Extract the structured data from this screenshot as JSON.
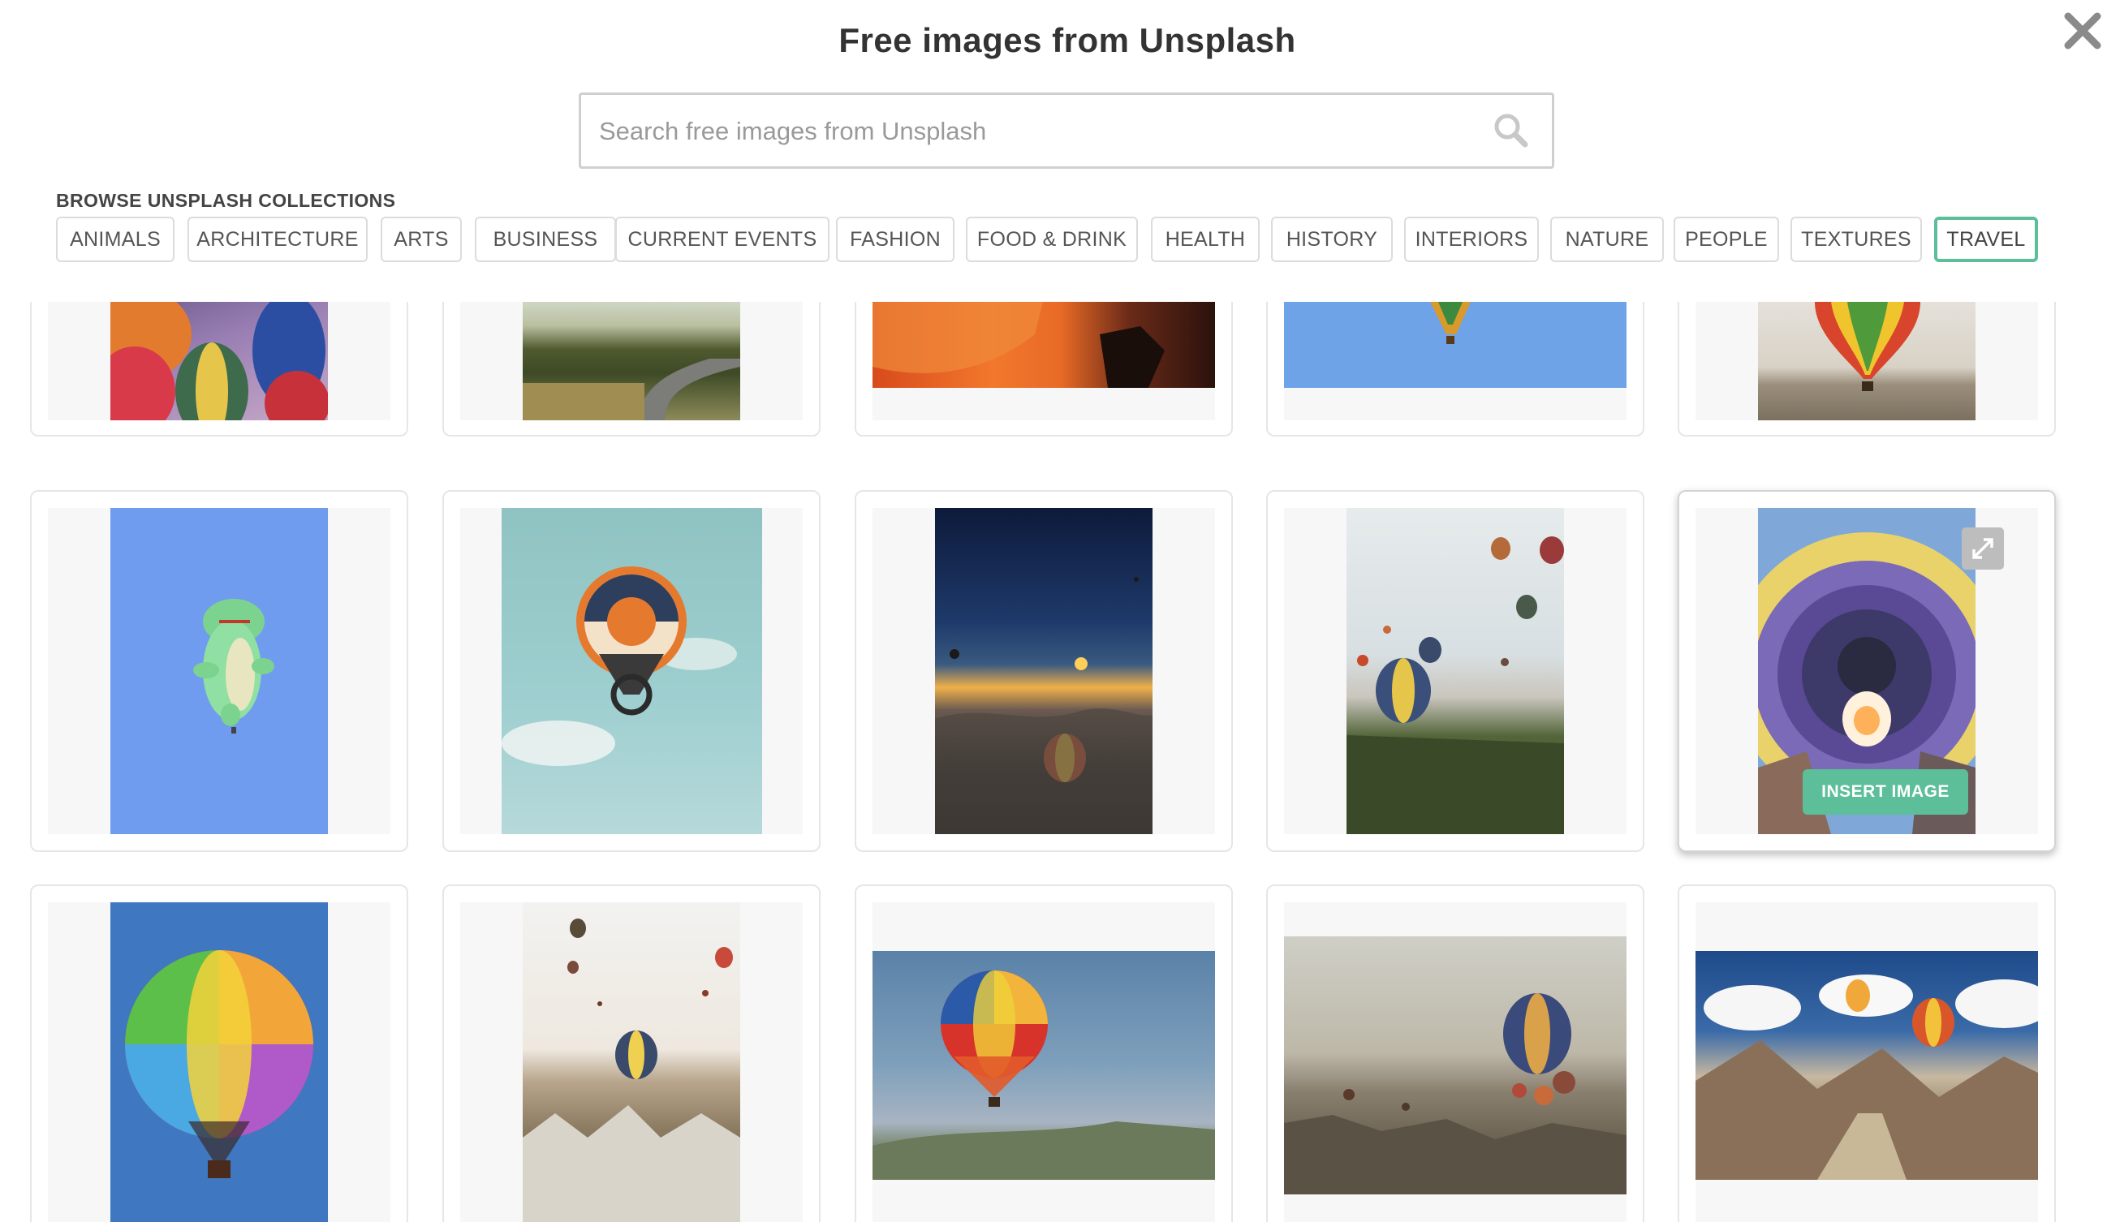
{
  "modal": {
    "title": "Free images from Unsplash",
    "close_icon": "close-icon"
  },
  "search": {
    "placeholder": "Search free images from Unsplash",
    "icon": "search-icon"
  },
  "collections": {
    "label": "BROWSE UNSPLASH COLLECTIONS",
    "items": [
      {
        "label": "ANIMALS"
      },
      {
        "label": "ARCHITECTURE"
      },
      {
        "label": "ARTS"
      },
      {
        "label": "BUSINESS"
      },
      {
        "label": "CURRENT EVENTS"
      },
      {
        "label": "FASHION"
      },
      {
        "label": "FOOD & DRINK"
      },
      {
        "label": "HEALTH"
      },
      {
        "label": "HISTORY"
      },
      {
        "label": "INTERIORS"
      },
      {
        "label": "NATURE"
      },
      {
        "label": "PEOPLE"
      },
      {
        "label": "TEXTURES"
      },
      {
        "label": "TRAVEL",
        "selected": true
      }
    ]
  },
  "hovered_card": {
    "insert_label": "INSERT IMAGE",
    "expand_icon": "expand-icon"
  },
  "colors": {
    "accent": "#5cbf9a",
    "chip_border": "#dcdcdc",
    "card_bg": "#f7f7f7"
  }
}
